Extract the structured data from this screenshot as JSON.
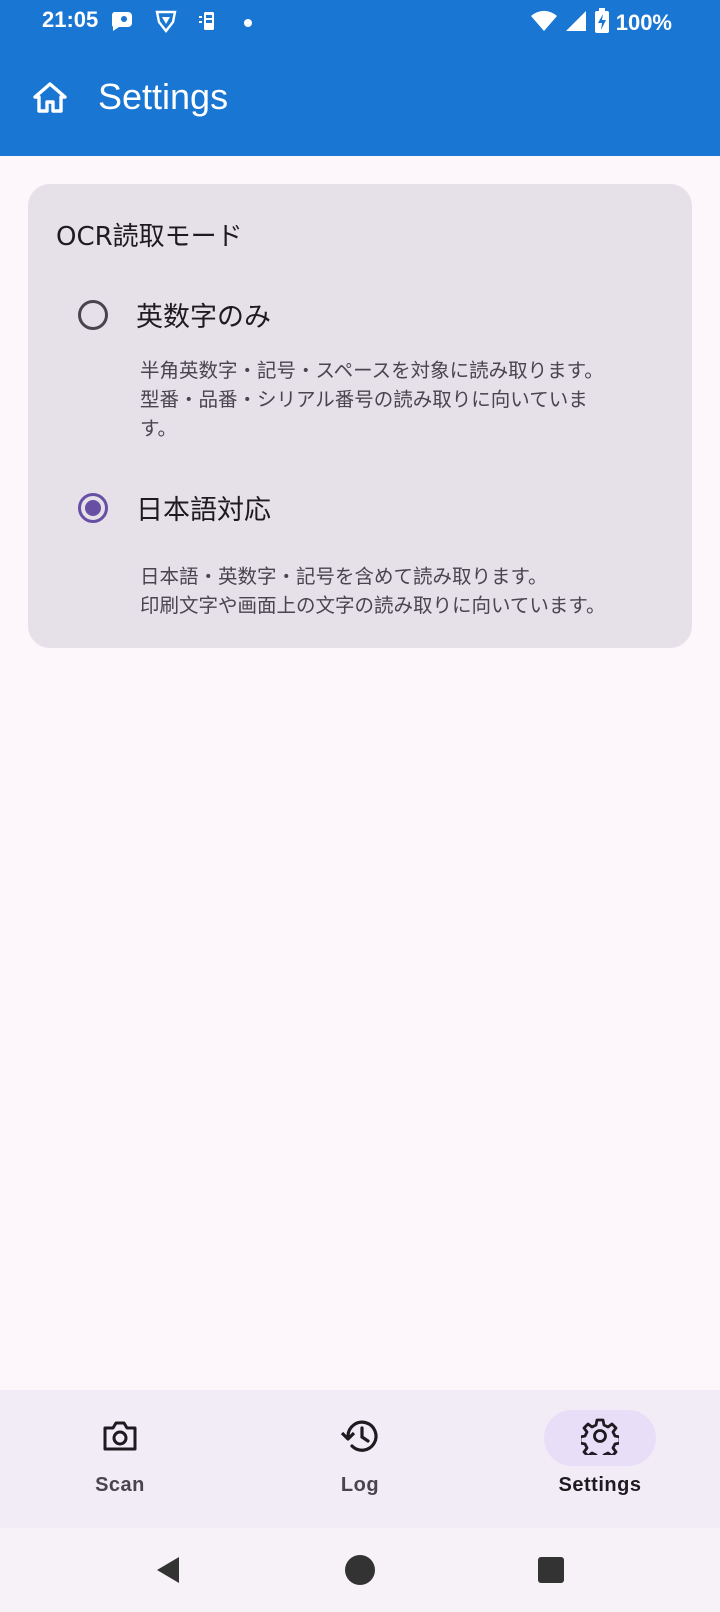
{
  "status_bar": {
    "time": "21:05",
    "left_icons": [
      "chat-bubble-icon",
      "vpn-shield-icon",
      "sim-card-icon",
      "notification-dot"
    ],
    "right_icons": [
      "wifi-icon",
      "signal-icon",
      "battery-charging-icon"
    ],
    "battery": "100%"
  },
  "app_bar": {
    "title": "Settings",
    "home_icon": "home-icon",
    "color": "#1976d2"
  },
  "settings_card": {
    "title": "OCR読取モード",
    "options": [
      {
        "label": "英数字のみ",
        "selected": false,
        "description_lines": [
          "半角英数字・記号・スペースを対象に読み取ります。",
          "型番・品番・シリアル番号の読み取りに向いていま",
          "す。"
        ]
      },
      {
        "label": "日本語対応",
        "selected": true,
        "description_lines": [
          "日本語・英数字・記号を含めて読み取ります。",
          "印刷文字や画面上の文字の読み取りに向いています。"
        ]
      }
    ],
    "accent_color": "#6750a4"
  },
  "bottom_nav": {
    "items": [
      {
        "label": "Scan",
        "icon": "camera-icon",
        "active": false
      },
      {
        "label": "Log",
        "icon": "history-icon",
        "active": false
      },
      {
        "label": "Settings",
        "icon": "gear-icon",
        "active": true
      }
    ]
  },
  "system_nav": {
    "buttons": [
      "back-icon",
      "home-circle-icon",
      "recents-icon"
    ]
  }
}
